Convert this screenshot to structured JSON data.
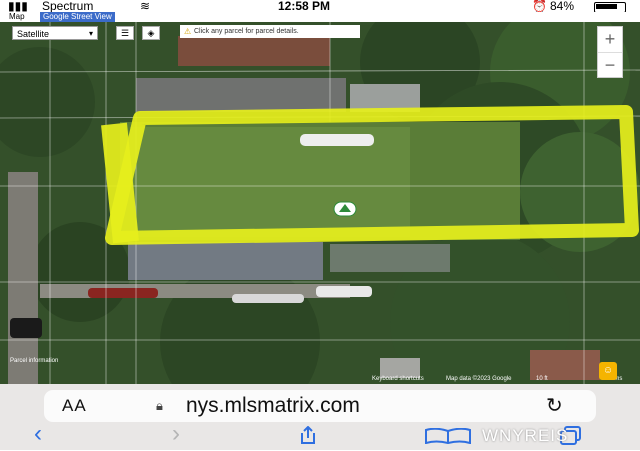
{
  "status_bar": {
    "carrier": "Spectrum",
    "time": "12:58 PM",
    "battery": "84%"
  },
  "map": {
    "type_tabs": [
      "Map",
      "Google Street View"
    ],
    "map_type_select": "Satellite",
    "parcel_hint": "Click any parcel for parcel details.",
    "zoom_in": "+",
    "zoom_out": "−",
    "credits_left": "Parcel information",
    "keyboard_shortcuts": "Keyboard shortcuts",
    "map_data": "Map data ©2023 Google",
    "scale": "10 ft",
    "terms": "Terms",
    "highlight_color": "#e6ef1c"
  },
  "browser": {
    "text_size_button": "AA",
    "url": "nys.mlsmatrix.com",
    "back_icon": "chevron-left-icon",
    "forward_icon": "chevron-right-icon",
    "share_icon": "share-icon",
    "bookmarks_icon": "book-icon",
    "tabs_icon": "tabs-icon"
  },
  "watermark": "WNYREIS"
}
